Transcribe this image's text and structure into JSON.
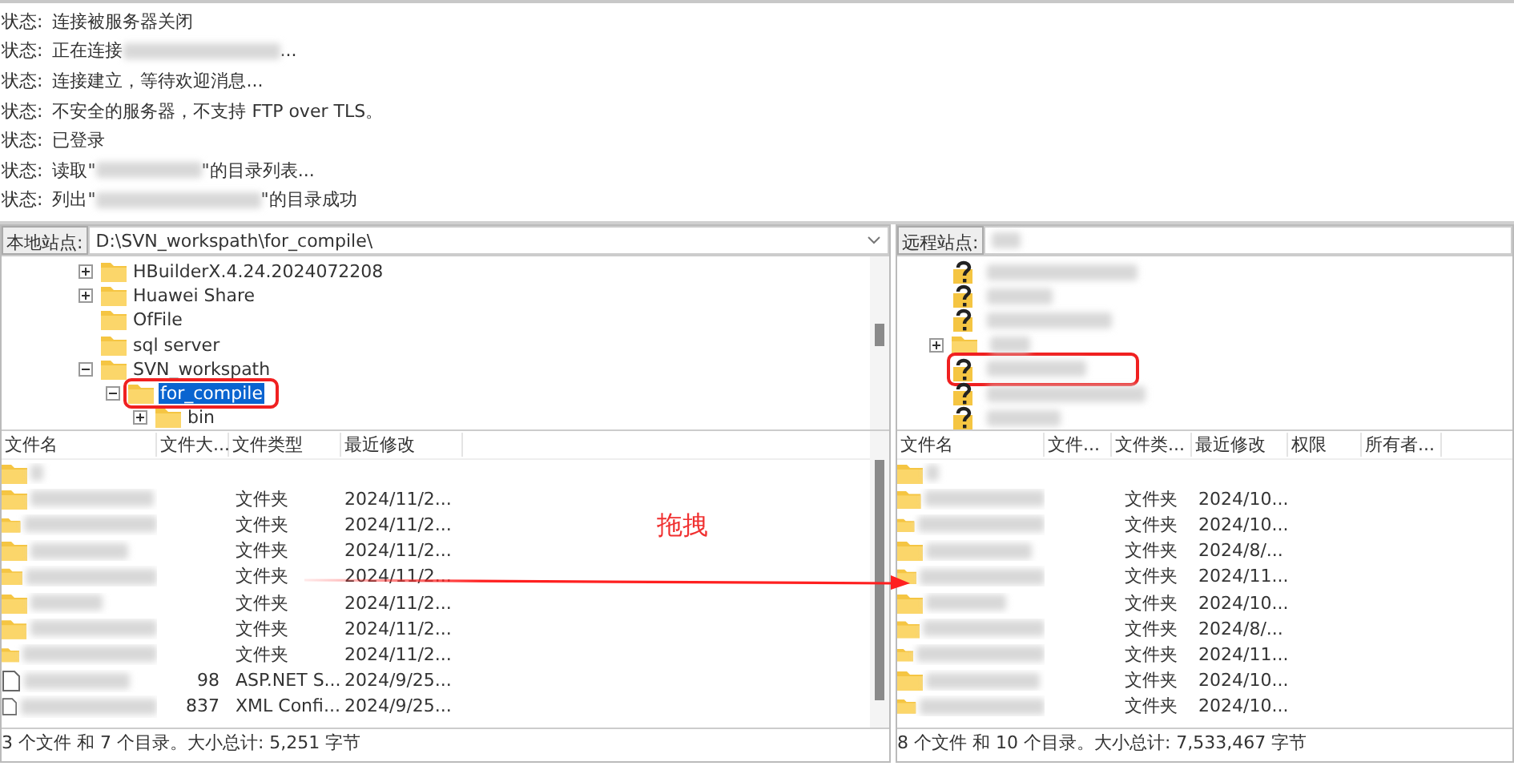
{
  "log": [
    {
      "label": "状态:",
      "parts": [
        {
          "kind": "text",
          "text": "连接被服务器关闭"
        }
      ]
    },
    {
      "label": "状态:",
      "parts": [
        {
          "kind": "text",
          "text": "正在连接"
        },
        {
          "kind": "blur"
        },
        {
          "kind": "text",
          "text": "..."
        }
      ]
    },
    {
      "label": "状态:",
      "parts": [
        {
          "kind": "text",
          "text": "连接建立，等待欢迎消息..."
        }
      ]
    },
    {
      "label": "状态:",
      "parts": [
        {
          "kind": "text",
          "text": "不安全的服务器，不支持 FTP over TLS。"
        }
      ]
    },
    {
      "label": "状态:",
      "parts": [
        {
          "kind": "text",
          "text": "已登录"
        }
      ]
    },
    {
      "label": "状态:",
      "parts": [
        {
          "kind": "text",
          "text": "读取\""
        },
        {
          "kind": "blur"
        },
        {
          "kind": "text",
          "text": "\"的目录列表..."
        }
      ]
    },
    {
      "label": "状态:",
      "parts": [
        {
          "kind": "text",
          "text": "列出\""
        },
        {
          "kind": "blur"
        },
        {
          "kind": "text",
          "text": "\"的目录成功"
        }
      ]
    }
  ],
  "local": {
    "site_label": "本地站点:",
    "path": "D:\\SVN_workspath\\for_compile\\",
    "tree": [
      {
        "name": "HBuilderX.4.24.2024072208",
        "kind": "collapsed",
        "selected": false,
        "highlighted": false
      },
      {
        "name": "Huawei Share",
        "kind": "collapsed",
        "selected": false,
        "highlighted": false
      },
      {
        "name": "OfFile",
        "kind": "leaf",
        "selected": false,
        "highlighted": false
      },
      {
        "name": "sql server",
        "kind": "leaf",
        "selected": false,
        "highlighted": false
      },
      {
        "name": "SVN_workspath",
        "kind": "expanded",
        "selected": false,
        "highlighted": false,
        "children": [
          {
            "name": "for_compile",
            "kind": "expanded",
            "selected": true,
            "highlighted": true,
            "children": [
              {
                "name": "bin",
                "kind": "collapsed",
                "selected": false,
                "highlighted": false
              }
            ]
          }
        ]
      }
    ],
    "columns": [
      "文件名",
      "文件大...",
      "文件类型",
      "最近修改"
    ],
    "rows": [
      {
        "kind": "parent"
      },
      {
        "kind": "folder",
        "type": "文件夹",
        "modified": "2024/11/2..."
      },
      {
        "kind": "folder",
        "type": "文件夹",
        "modified": "2024/11/2..."
      },
      {
        "kind": "folder",
        "type": "文件夹",
        "modified": "2024/11/2..."
      },
      {
        "kind": "folder",
        "type": "文件夹",
        "modified": "2024/11/2..."
      },
      {
        "kind": "folder",
        "type": "文件夹",
        "modified": "2024/11/2..."
      },
      {
        "kind": "folder",
        "type": "文件夹",
        "modified": "2024/11/2..."
      },
      {
        "kind": "folder",
        "type": "文件夹",
        "modified": "2024/11/2..."
      },
      {
        "kind": "file",
        "size": "98",
        "type": "ASP.NET S...",
        "modified": "2024/9/25..."
      },
      {
        "kind": "file",
        "size": "837",
        "type": "XML Confi...",
        "modified": "2024/9/25..."
      }
    ],
    "status": "3 个文件 和 7 个目录。大小总计: 5,251 字节"
  },
  "remote": {
    "site_label": "远程站点:",
    "tree": [
      {
        "kind": "unknown",
        "highlighted": false
      },
      {
        "kind": "unknown",
        "highlighted": false
      },
      {
        "kind": "unknown",
        "highlighted": false
      },
      {
        "kind": "collapsed",
        "highlighted": false
      },
      {
        "kind": "unknown",
        "highlighted": true
      },
      {
        "kind": "unknown",
        "highlighted": false
      },
      {
        "kind": "unknown",
        "highlighted": false
      }
    ],
    "columns": [
      "文件名",
      "文件...",
      "文件类...",
      "最近修改",
      "权限",
      "所有者..."
    ],
    "rows": [
      {
        "kind": "parent"
      },
      {
        "kind": "folder",
        "type": "文件夹",
        "modified": "2024/10..."
      },
      {
        "kind": "folder",
        "type": "文件夹",
        "modified": "2024/10..."
      },
      {
        "kind": "folder",
        "type": "文件夹",
        "modified": "2024/8/..."
      },
      {
        "kind": "folder",
        "type": "文件夹",
        "modified": "2024/11..."
      },
      {
        "kind": "folder",
        "type": "文件夹",
        "modified": "2024/10..."
      },
      {
        "kind": "folder",
        "type": "文件夹",
        "modified": "2024/8/..."
      },
      {
        "kind": "folder",
        "type": "文件夹",
        "modified": "2024/11..."
      },
      {
        "kind": "folder",
        "type": "文件夹",
        "modified": "2024/10..."
      },
      {
        "kind": "folder",
        "type": "文件夹",
        "modified": "2024/10..."
      }
    ],
    "status": "8 个文件 和 10 个目录。大小总计: 7,533,467 字节"
  },
  "annotation": {
    "text": "拖拽"
  }
}
